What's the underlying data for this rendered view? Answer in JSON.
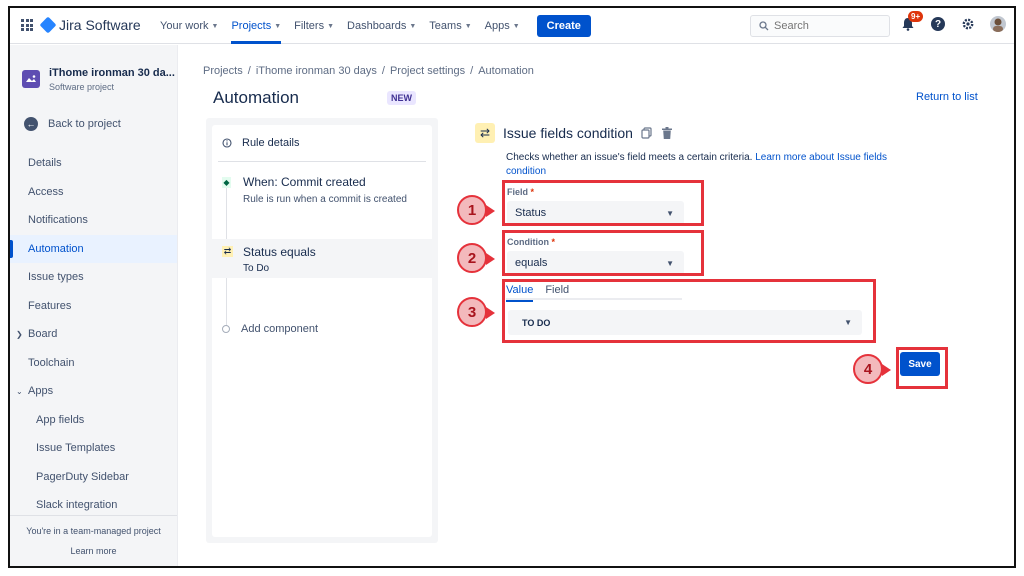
{
  "topnav": {
    "logo": "Jira Software",
    "items": [
      {
        "label": "Your work"
      },
      {
        "label": "Projects"
      },
      {
        "label": "Filters"
      },
      {
        "label": "Dashboards"
      },
      {
        "label": "Teams"
      },
      {
        "label": "Apps"
      }
    ],
    "create_label": "Create",
    "search_placeholder": "Search",
    "notifications_badge": "9+"
  },
  "sidebar": {
    "project_name": "iThome ironman 30 da...",
    "project_type": "Software project",
    "back_label": "Back to project",
    "items": [
      {
        "label": "Details"
      },
      {
        "label": "Access"
      },
      {
        "label": "Notifications"
      },
      {
        "label": "Automation"
      },
      {
        "label": "Issue types"
      },
      {
        "label": "Features"
      },
      {
        "label": "Board"
      },
      {
        "label": "Toolchain"
      },
      {
        "label": "Apps"
      },
      {
        "label": "App fields"
      },
      {
        "label": "Issue Templates"
      },
      {
        "label": "PagerDuty Sidebar"
      },
      {
        "label": "Slack integration"
      }
    ],
    "footer_text": "You're in a team-managed project",
    "footer_link": "Learn more"
  },
  "breadcrumb": [
    "Projects",
    "iThome ironman 30 days",
    "Project settings",
    "Automation"
  ],
  "breadcrumb_sep": "/",
  "page": {
    "title": "Automation",
    "new_lozenge": "NEW",
    "return_link": "Return to list"
  },
  "rule": {
    "details_label": "Rule details",
    "trigger_title": "When: Commit created",
    "trigger_desc": "Rule is run when a commit is created",
    "condition_title": "Status equals",
    "condition_desc": "To Do",
    "add_component": "Add component"
  },
  "condition_panel": {
    "title": "Issue fields condition",
    "description": "Checks whether an issue's field meets a certain criteria.",
    "learn_more": "Learn more about Issue fields condition",
    "field_label": "Field",
    "field_value": "Status",
    "condition_label": "Condition",
    "condition_value": "equals",
    "tabs": [
      "Value",
      "Field"
    ],
    "value_selected": "TO DO",
    "required_mark": "*",
    "save_label": "Save"
  },
  "callouts": [
    "1",
    "2",
    "3",
    "4"
  ],
  "colors": {
    "brand_blue": "#0052cc",
    "annotation_red": "#e5323b",
    "required_red": "#de350b"
  }
}
